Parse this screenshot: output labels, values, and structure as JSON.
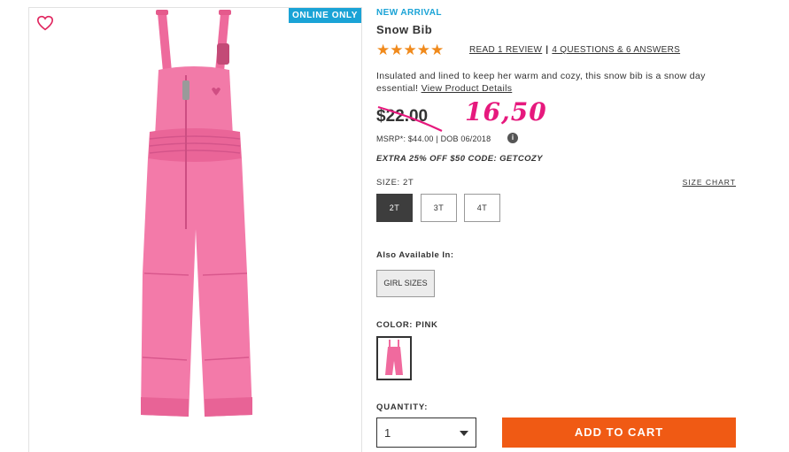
{
  "image_panel": {
    "badge": "ONLINE ONLY",
    "heart_icon": "heart-outline-icon"
  },
  "product": {
    "tag": "NEW ARRIVAL",
    "title": "Snow Bib",
    "rating_stars": "★★★★★",
    "rating_value": 5,
    "read_reviews": "READ 1 REVIEW",
    "separator": "|",
    "questions": "4 QUESTIONS & 6 ANSWERS",
    "description": "Insulated and lined to keep her warm and cozy, this snow bib is a snow day essential!",
    "view_details": "View Product Details",
    "old_price": "$22.00",
    "handwritten_price": "16,50",
    "msrp": "MSRP*: $44.00 | DOB 06/2018",
    "info_icon": "i",
    "promo": "EXTRA 25% OFF $50 CODE: GETCOZY"
  },
  "size": {
    "label": "SIZE: 2T",
    "chart_link": "SIZE CHART",
    "options": [
      "2T",
      "3T",
      "4T"
    ],
    "selected": "2T"
  },
  "also_available": {
    "label": "Also Available In:",
    "button": "GIRL SIZES"
  },
  "color": {
    "label": "COLOR: PINK",
    "swatch": "pink"
  },
  "quantity": {
    "label": "QUANTITY:",
    "value": "1"
  },
  "cart": {
    "button": "ADD TO CART"
  },
  "colors": {
    "accent_blue": "#1aa3d6",
    "star_orange": "#f08a1c",
    "cart_orange": "#f05a14",
    "product_pink": "#f06a9e",
    "handwritten_magenta": "#e6197d"
  }
}
